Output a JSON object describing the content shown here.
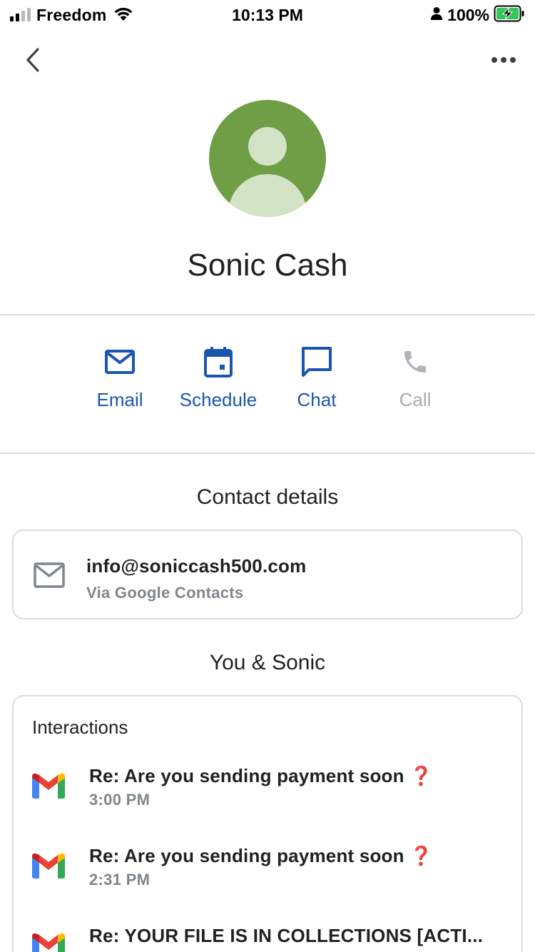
{
  "status_bar": {
    "carrier": "Freedom",
    "time": "10:13 PM",
    "battery": "100%"
  },
  "nav": {
    "back_icon": "chevron-left-icon",
    "more_icon": "more-horizontal-icon"
  },
  "contact": {
    "name": "Sonic Cash",
    "avatar_color": "#6f9e47"
  },
  "actions": [
    {
      "label": "Email",
      "icon": "mail-icon",
      "enabled": true
    },
    {
      "label": "Schedule",
      "icon": "calendar-icon",
      "enabled": true
    },
    {
      "label": "Chat",
      "icon": "chat-icon",
      "enabled": true
    },
    {
      "label": "Call",
      "icon": "phone-icon",
      "enabled": false
    }
  ],
  "contact_details": {
    "title": "Contact details",
    "email": "info@soniccash500.com",
    "source": "Via Google Contacts"
  },
  "you_and": {
    "title": "You & Sonic",
    "interactions_title": "Interactions",
    "items": [
      {
        "subject": "Re: Are you sending payment soon",
        "emoji": "❓",
        "time": "3:00 PM"
      },
      {
        "subject": "Re: Are you sending payment soon",
        "emoji": "❓",
        "time": "2:31 PM"
      },
      {
        "subject": "Re: YOUR FILE IS IN COLLECTIONS [ACTI...",
        "emoji": "",
        "time": ""
      }
    ]
  },
  "colors": {
    "accent": "#1a56b0",
    "disabled": "#a8abaf",
    "divider": "#dadce0"
  }
}
